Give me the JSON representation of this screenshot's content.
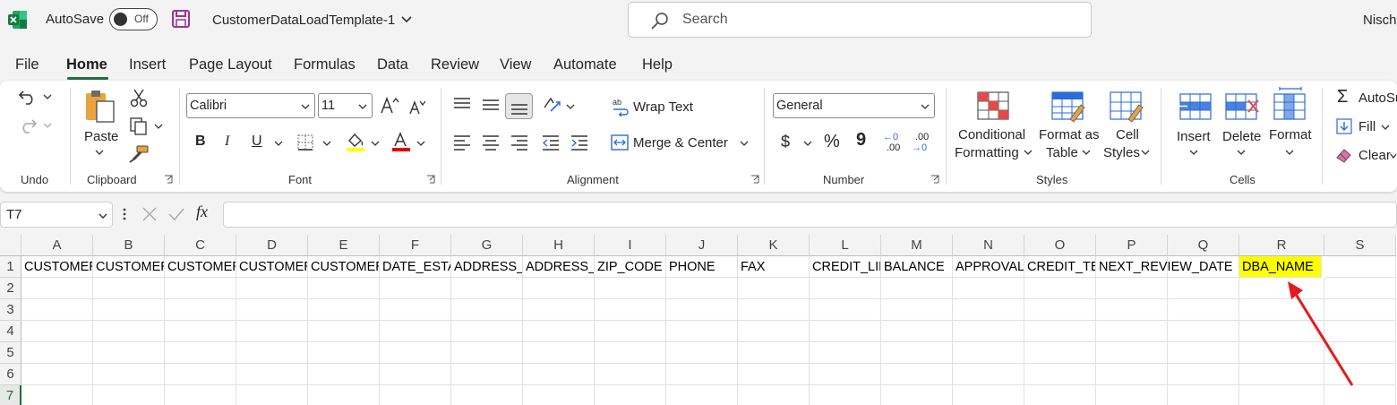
{
  "titlebar": {
    "autosave_label": "AutoSave",
    "toggle_state": "Off",
    "file_name": "CustomerDataLoadTemplate-1",
    "search_placeholder": "Search",
    "user_name": "Nisch"
  },
  "menu": [
    "File",
    "Home",
    "Insert",
    "Page Layout",
    "Formulas",
    "Data",
    "Review",
    "View",
    "Automate",
    "Help"
  ],
  "ribbon": {
    "undo_group": "Undo",
    "clipboard": {
      "paste": "Paste",
      "group": "Clipboard"
    },
    "font": {
      "name": "Calibri",
      "size": "11",
      "group": "Font",
      "bold": "B",
      "italic": "I",
      "underline": "U"
    },
    "alignment": {
      "wrap_text": "Wrap Text",
      "merge_center": "Merge & Center",
      "group": "Alignment"
    },
    "number": {
      "format": "General",
      "group": "Number",
      "currency": "$",
      "percent": "%",
      "comma": "9",
      "inc_decimal_top": "←0",
      "inc_decimal_bottom": ".00",
      "dec_decimal_top": ".00",
      "dec_decimal_bottom": "→0"
    },
    "styles": {
      "conditional_1": "Conditional",
      "conditional_2": "Formatting",
      "format_table_1": "Format as",
      "format_table_2": "Table",
      "cell_styles_1": "Cell",
      "cell_styles_2": "Styles",
      "group": "Styles"
    },
    "cells": {
      "insert": "Insert",
      "delete": "Delete",
      "format": "Format",
      "group": "Cells"
    },
    "editing": {
      "autosum": "AutoSu",
      "fill": "Fill",
      "clear": "Clear"
    }
  },
  "formula_bar": {
    "name_box": "T7",
    "fx": "fx",
    "value": ""
  },
  "columns": [
    "A",
    "B",
    "C",
    "D",
    "E",
    "F",
    "G",
    "H",
    "I",
    "J",
    "K",
    "L",
    "M",
    "N",
    "O",
    "P",
    "Q",
    "R",
    "S"
  ],
  "rows": [
    "1",
    "2",
    "3",
    "4",
    "5",
    "6",
    "7"
  ],
  "row1": [
    "CUSTOMER_",
    "CUSTOMER_",
    "CUSTOMER_",
    "CUSTOMER_",
    "CUSTOMER_",
    "DATE_ESTABLISHED",
    "ADDRESS_",
    "ADDRESS_",
    "ZIP_CODE",
    "PHONE",
    "FAX",
    "CREDIT_LIMIT",
    "BALANCE",
    "APPROVAL",
    "CREDIT_TERMS",
    "NEXT_REVIEW_DATE",
    "",
    "DBA_NAME",
    ""
  ],
  "highlight_color": "#ffff00",
  "arrow_color": "#e8191c",
  "accent_green": "#1e6e3e"
}
